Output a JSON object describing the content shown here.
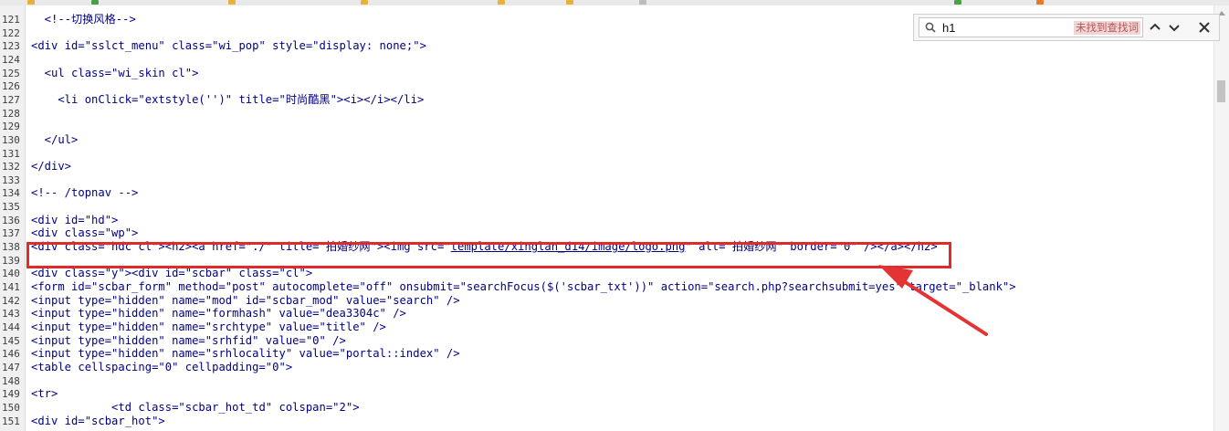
{
  "find_bar": {
    "query": "h1",
    "status": "未找到查找词",
    "prev_label": "previous-match",
    "next_label": "next-match",
    "close_label": "close"
  },
  "colors": {
    "code": "#000080",
    "highlight_box": "#e02b2b",
    "arrow": "#e53333",
    "not_found_bg": "#f2d6d6"
  },
  "lines": [
    {
      "n": "121",
      "code": "  <!--切换风格-->"
    },
    {
      "n": "122",
      "code": ""
    },
    {
      "n": "123",
      "code": "<div id=\"sslct_menu\" class=\"wi_pop\" style=\"display: none;\">"
    },
    {
      "n": "124",
      "code": ""
    },
    {
      "n": "125",
      "code": "  <ul class=\"wi_skin cl\">"
    },
    {
      "n": "126",
      "code": ""
    },
    {
      "n": "127",
      "code": "    <li onClick=\"extstyle('')\" title=\"时尚酷黑\"><i></i></li>"
    },
    {
      "n": "128",
      "code": ""
    },
    {
      "n": "129",
      "code": ""
    },
    {
      "n": "130",
      "code": "  </ul>"
    },
    {
      "n": "131",
      "code": ""
    },
    {
      "n": "132",
      "code": "</div>"
    },
    {
      "n": "133",
      "code": ""
    },
    {
      "n": "134",
      "code": "<!-- /topnav -->"
    },
    {
      "n": "135",
      "code": ""
    },
    {
      "n": "136",
      "code": "<div id=\"hd\">"
    },
    {
      "n": "137",
      "code": "<div class=\"wp\">"
    },
    {
      "n": "138",
      "code": "<div class=\"hdc cl\"><h2><a href=\"./\" title=\"拍婚纱网\"><img src=\"",
      "link": "template/xinglan_d14/image/logo.png",
      "code_after": "\" alt=\"拍婚纱网\" border=\"0\" /></a></h2>"
    },
    {
      "n": "139",
      "code": ""
    },
    {
      "n": "140",
      "code": "<div class=\"y\"><div id=\"scbar\" class=\"cl\">"
    },
    {
      "n": "141",
      "code": "<form id=\"scbar_form\" method=\"post\" autocomplete=\"off\" onsubmit=\"searchFocus($('scbar_txt'))\" action=\"search.php?searchsubmit=yes\" target=\"_blank\">"
    },
    {
      "n": "142",
      "code": "<input type=\"hidden\" name=\"mod\" id=\"scbar_mod\" value=\"search\" />"
    },
    {
      "n": "143",
      "code": "<input type=\"hidden\" name=\"formhash\" value=\"dea3304c\" />"
    },
    {
      "n": "144",
      "code": "<input type=\"hidden\" name=\"srchtype\" value=\"title\" />"
    },
    {
      "n": "145",
      "code": "<input type=\"hidden\" name=\"srhfid\" value=\"0\" />"
    },
    {
      "n": "146",
      "code": "<input type=\"hidden\" name=\"srhlocality\" value=\"portal::index\" />"
    },
    {
      "n": "147",
      "code": "<table cellspacing=\"0\" cellpadding=\"0\">"
    },
    {
      "n": "148",
      "code": ""
    },
    {
      "n": "149",
      "code": "<tr>"
    },
    {
      "n": "150",
      "code": "            <td class=\"scbar_hot_td\" colspan=\"2\">"
    },
    {
      "n": "151",
      "code": "<div id=\"scbar_hot\">"
    }
  ]
}
